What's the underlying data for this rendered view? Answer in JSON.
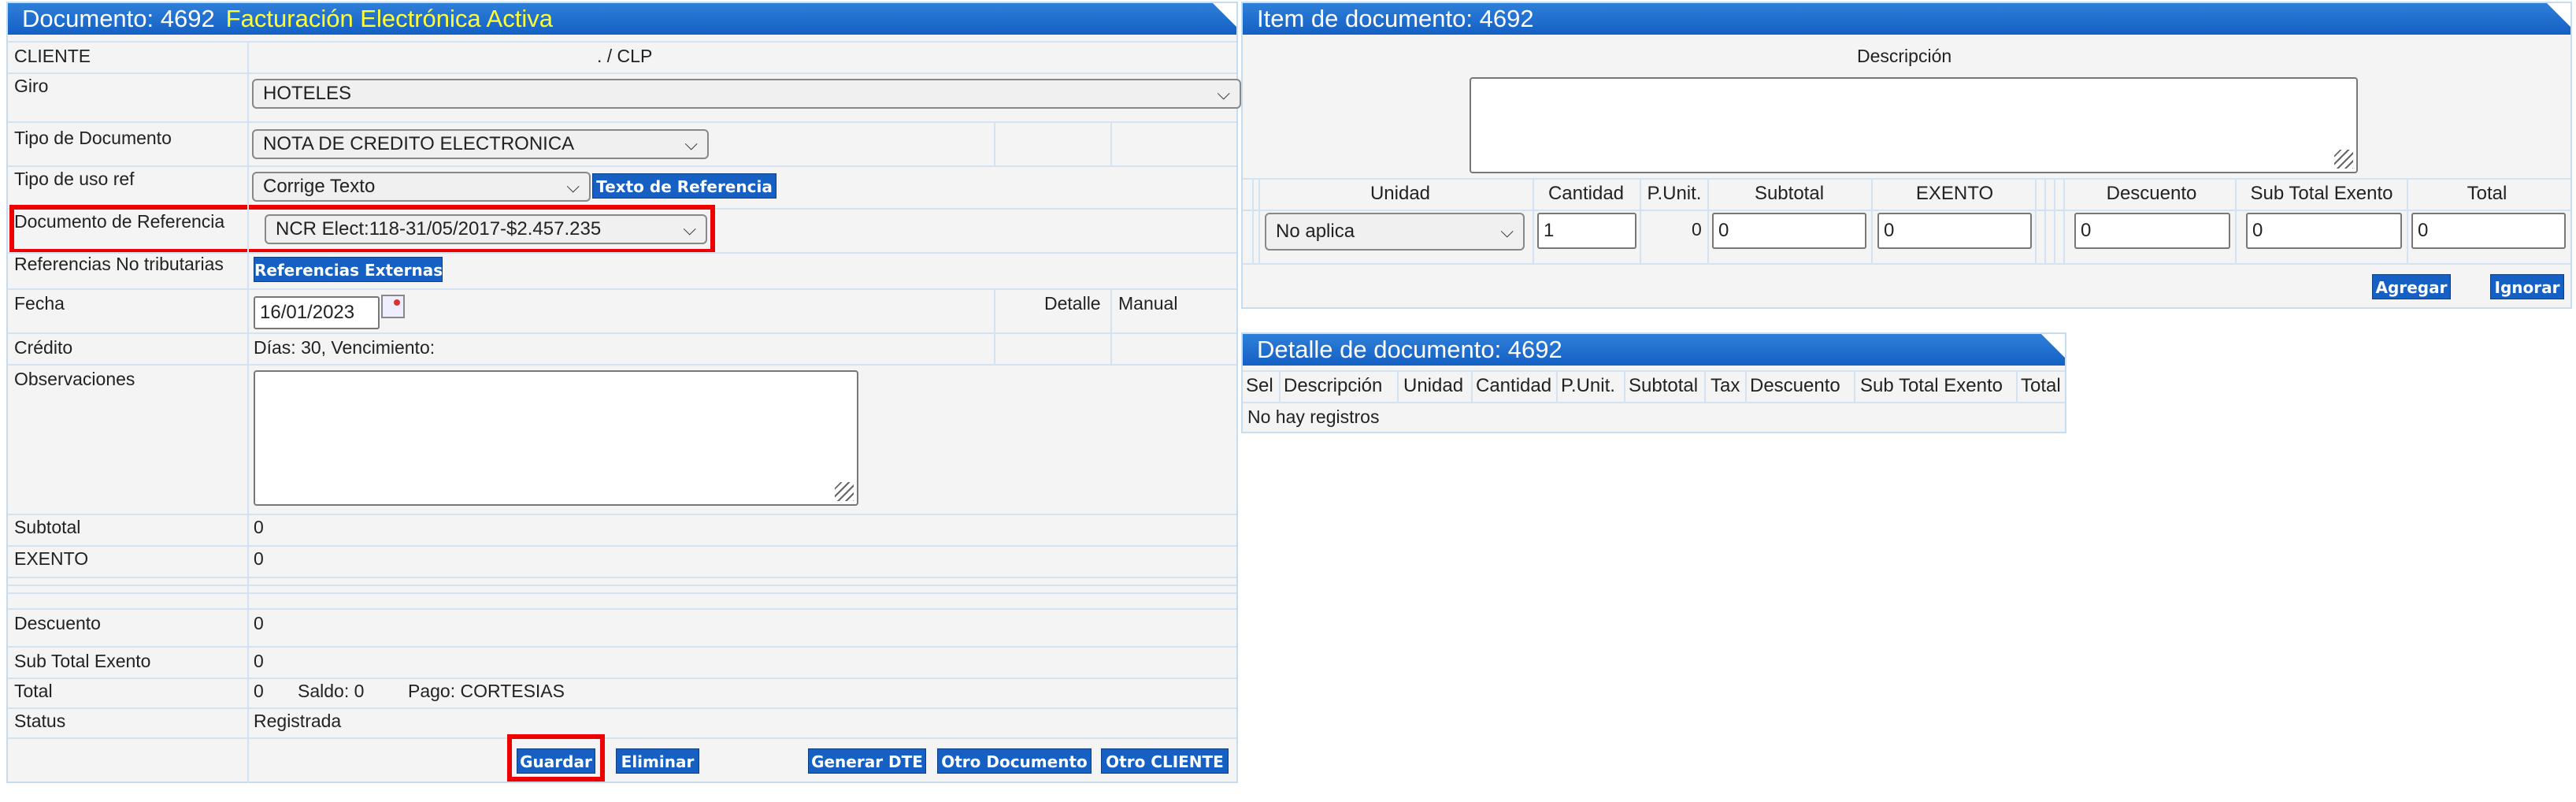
{
  "left_panel": {
    "title": "Documento: 4692",
    "title_status": "Facturación Electrónica Activa",
    "cliente_label": "CLIENTE",
    "cliente_value": ". / CLP",
    "giro_label": "Giro",
    "giro_value": "HOTELES",
    "tipo_doc_label": "Tipo de Documento",
    "tipo_doc_value": "NOTA DE CREDITO ELECTRONICA",
    "tipo_uso_label": "Tipo de uso ref",
    "tipo_uso_value": "Corrige Texto",
    "texto_ref_button": "Texto de Referencia",
    "doc_ref_label": "Documento de Referencia",
    "doc_ref_value": "NCR Elect:118-31/05/2017-$2.457.235",
    "ref_no_trib_label": "Referencias No tributarias",
    "ref_externas_button": "Referencias Externas",
    "fecha_label": "Fecha",
    "fecha_value": "16/01/2023",
    "detalle_label": "Detalle",
    "manual_label": "Manual",
    "credito_label": "Crédito",
    "credito_value": "Días: 30, Vencimiento:",
    "observaciones_label": "Observaciones",
    "subtotal_label": "Subtotal",
    "subtotal_value": "0",
    "exento_label": "EXENTO",
    "exento_value": "0",
    "descuento_label": "Descuento",
    "descuento_value": "0",
    "sub_total_exento_label": "Sub Total Exento",
    "sub_total_exento_value": "0",
    "total_label": "Total",
    "total_value": "0",
    "saldo_text": "Saldo: 0",
    "pago_text": "Pago: CORTESIAS",
    "status_label": "Status",
    "status_value": "Registrada",
    "buttons": {
      "guardar": "Guardar",
      "eliminar": "Eliminar",
      "generar_dte": "Generar DTE",
      "otro_documento": "Otro Documento",
      "otro_cliente": "Otro CLIENTE"
    }
  },
  "item_panel": {
    "title": "Item de documento: 4692",
    "descripcion_label": "Descripción",
    "columns": {
      "unidad": "Unidad",
      "cantidad": "Cantidad",
      "punit": "P.Unit.",
      "subtotal": "Subtotal",
      "exento": "EXENTO",
      "descuento": "Descuento",
      "sub_total_exento": "Sub Total Exento",
      "total": "Total"
    },
    "unidad_value": "No aplica",
    "cantidad_value": "1",
    "punit_value": "0",
    "subtotal_value": "0",
    "exento_value": "0",
    "descuento_value": "0",
    "sub_total_exento_value": "0",
    "total_value": "0",
    "agregar_button": "Agregar",
    "ignorar_button": "Ignorar"
  },
  "detalle_panel": {
    "title": "Detalle de documento: 4692",
    "columns": [
      "Sel",
      "Descripción",
      "Unidad",
      "Cantidad",
      "P.Unit.",
      "Subtotal",
      "Tax",
      "Descuento",
      "Sub Total Exento",
      "Total"
    ],
    "empty_text": "No hay registros"
  },
  "colors": {
    "header_blue": "#1460c4",
    "title_status_yellow": "#ffff33",
    "highlight_red": "#ee0000"
  }
}
